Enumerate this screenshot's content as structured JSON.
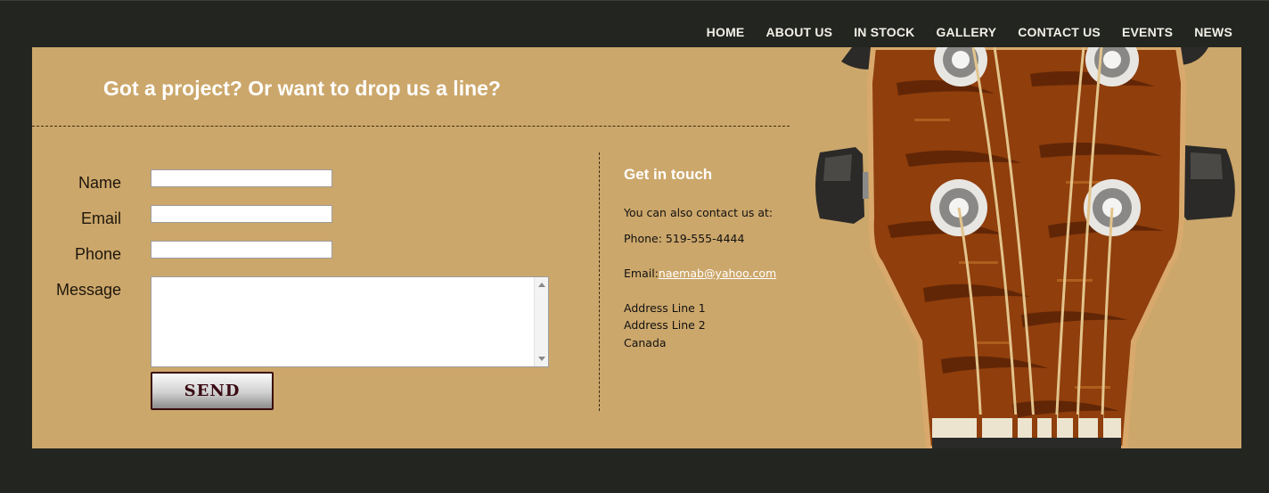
{
  "nav": {
    "items": [
      "HOME",
      "ABOUT US",
      "IN STOCK",
      "GALLERY",
      "CONTACT US",
      "EVENTS",
      "NEWS"
    ]
  },
  "heading": "Got a project? Or want to drop us a line?",
  "form": {
    "name_label": "Name",
    "email_label": "Email",
    "phone_label": "Phone",
    "message_label": "Message",
    "name_value": "",
    "email_value": "",
    "phone_value": "",
    "message_value": "",
    "send_label": "SEND"
  },
  "contact": {
    "title": "Get in touch",
    "intro": "You can also contact us at:",
    "phone": "Phone: 519-555-4444",
    "email_label": "Email:",
    "email": "naemab@yahoo.com",
    "address": [
      "Address Line 1",
      "Address Line 2",
      "Canada"
    ]
  },
  "colors": {
    "background": "#232520",
    "panel": "#cca76b",
    "guitar_wood": "#8f3e0c"
  },
  "image": {
    "icon": "guitar-headstock-image"
  }
}
